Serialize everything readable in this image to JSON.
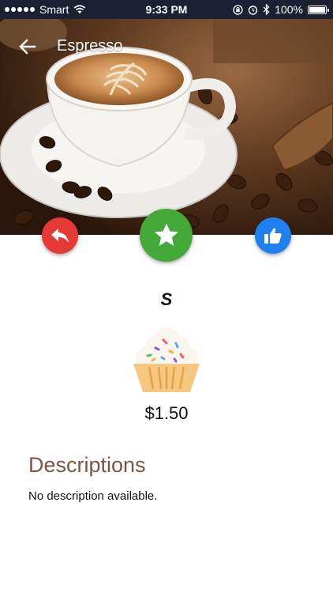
{
  "status_bar": {
    "carrier": "Smart",
    "time": "9:33 PM",
    "battery_percent": "100%",
    "battery_level": 1.0,
    "icons": [
      "signal-dots-icon",
      "wifi-icon",
      "orientation-lock-icon",
      "alarm-icon",
      "bluetooth-icon",
      "battery-icon"
    ]
  },
  "app_bar": {
    "title": "Espresso",
    "back_icon": "arrow-left-icon"
  },
  "actions": {
    "reply_icon": "reply-icon",
    "favorite_icon": "star-icon",
    "like_icon": "thumbs-up-icon",
    "colors": {
      "reply": "#e53935",
      "favorite": "#43a939",
      "like": "#1f80f0"
    }
  },
  "product": {
    "name": "S",
    "category_icon": "cupcake-icon",
    "price": "$1.50"
  },
  "details": {
    "heading": "Descriptions",
    "text": "No description available.",
    "heading_color": "#7b5645"
  }
}
